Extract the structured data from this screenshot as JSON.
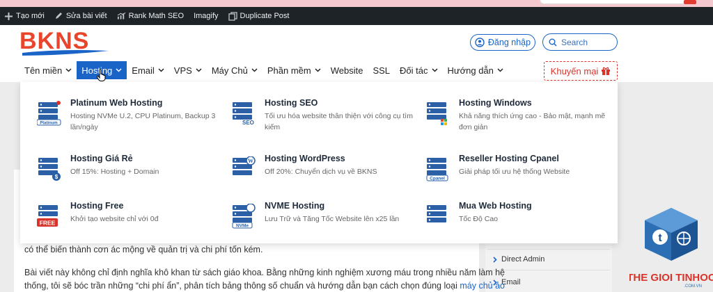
{
  "colors": {
    "brand_blue": "#1a64c8",
    "brand_red": "#e8452c",
    "admin_bar": "#1d2327",
    "promo_red": "#d9342b"
  },
  "admin_bar": {
    "items": [
      {
        "icon": "plus-icon",
        "label": "Tạo mới"
      },
      {
        "icon": "pencil-icon",
        "label": "Sửa bài viết"
      },
      {
        "icon": "rank-math-icon",
        "label": "Rank Math SEO"
      },
      {
        "icon": "",
        "label": "Imagify"
      },
      {
        "icon": "duplicate-icon",
        "label": "Duplicate Post"
      }
    ]
  },
  "header": {
    "logo_text": "BKNS",
    "login_label": "Đăng nhập",
    "search_placeholder": "Search",
    "promo_label": "Khuyến mại"
  },
  "nav": {
    "items": [
      {
        "label": "Tên miền",
        "has_dropdown": true,
        "active": false
      },
      {
        "label": "Hosting",
        "has_dropdown": true,
        "active": true
      },
      {
        "label": "Email",
        "has_dropdown": true,
        "active": false
      },
      {
        "label": "VPS",
        "has_dropdown": true,
        "active": false
      },
      {
        "label": "Máy Chủ",
        "has_dropdown": true,
        "active": false
      },
      {
        "label": "Phần mềm",
        "has_dropdown": true,
        "active": false
      },
      {
        "label": "Website",
        "has_dropdown": false,
        "active": false
      },
      {
        "label": "SSL",
        "has_dropdown": false,
        "active": false
      },
      {
        "label": "Đối tác",
        "has_dropdown": true,
        "active": false
      },
      {
        "label": "Hướng dẫn",
        "has_dropdown": true,
        "active": false
      }
    ]
  },
  "mega_menu": {
    "items": [
      {
        "title": "Platinum Web Hosting",
        "desc": "Hosting NVMe U.2, CPU Platinum, Backup 3 lần/ngày",
        "icon": "server-platinum-icon",
        "badge": "Platinum"
      },
      {
        "title": "Hosting SEO",
        "desc": "Tối ưu hóa website thân thiện với công cụ tìm kiếm",
        "icon": "server-seo-icon",
        "badge": "SEO"
      },
      {
        "title": "Hosting Windows",
        "desc": "Khả năng thích ứng cao - Bảo mật, mạnh mẽ đơn giản",
        "icon": "server-windows-icon",
        "badge": ""
      },
      {
        "title": "Hosting Giá Rẻ",
        "desc": "Off 15%: Hosting + Domain",
        "icon": "server-dollar-icon",
        "badge": "$"
      },
      {
        "title": "Hosting WordPress",
        "desc": "Off 20%: Chuyển dịch vụ về BKNS",
        "icon": "server-wordpress-icon",
        "badge": "W"
      },
      {
        "title": "Reseller Hosting Cpanel",
        "desc": "Giải pháp tối ưu hệ thống Website",
        "icon": "server-cpanel-icon",
        "badge": "Cpanel"
      },
      {
        "title": "Hosting Free",
        "desc": "Khởi tạo website chỉ với 0đ",
        "icon": "server-free-icon",
        "badge": "FREE"
      },
      {
        "title": "NVME Hosting",
        "desc": "Lưu Trữ và Tăng Tốc Website lên x25 lần",
        "icon": "server-nvme-icon",
        "badge": "NVMe"
      },
      {
        "title": "Mua Web Hosting",
        "desc": "Tốc Độ Cao",
        "icon": "server-cart-icon",
        "badge": ""
      }
    ]
  },
  "article": {
    "line1": "có thể biến thành cơn ác mộng về quản trị và chi phí tốn kém.",
    "line2": "Bài viết này không chỉ định nghĩa khô khan từ sách giáo khoa. Bằng những kinh nghiệm xương máu trong nhiều năm làm hệ",
    "line3": "thống, tôi sẽ bóc trần những “chi phí ẩn”, phân tích bảng thông số chuẩn và hướng dẫn bạn cách chọn đúng loại ",
    "line3_link": "máy chủ ảo"
  },
  "sidebar": {
    "links": [
      {
        "label": "Direct Admin"
      },
      {
        "label": "Email"
      }
    ]
  },
  "watermark": {
    "text": "THE GIOI TINHOC",
    "subtext": ".COM.VN"
  }
}
